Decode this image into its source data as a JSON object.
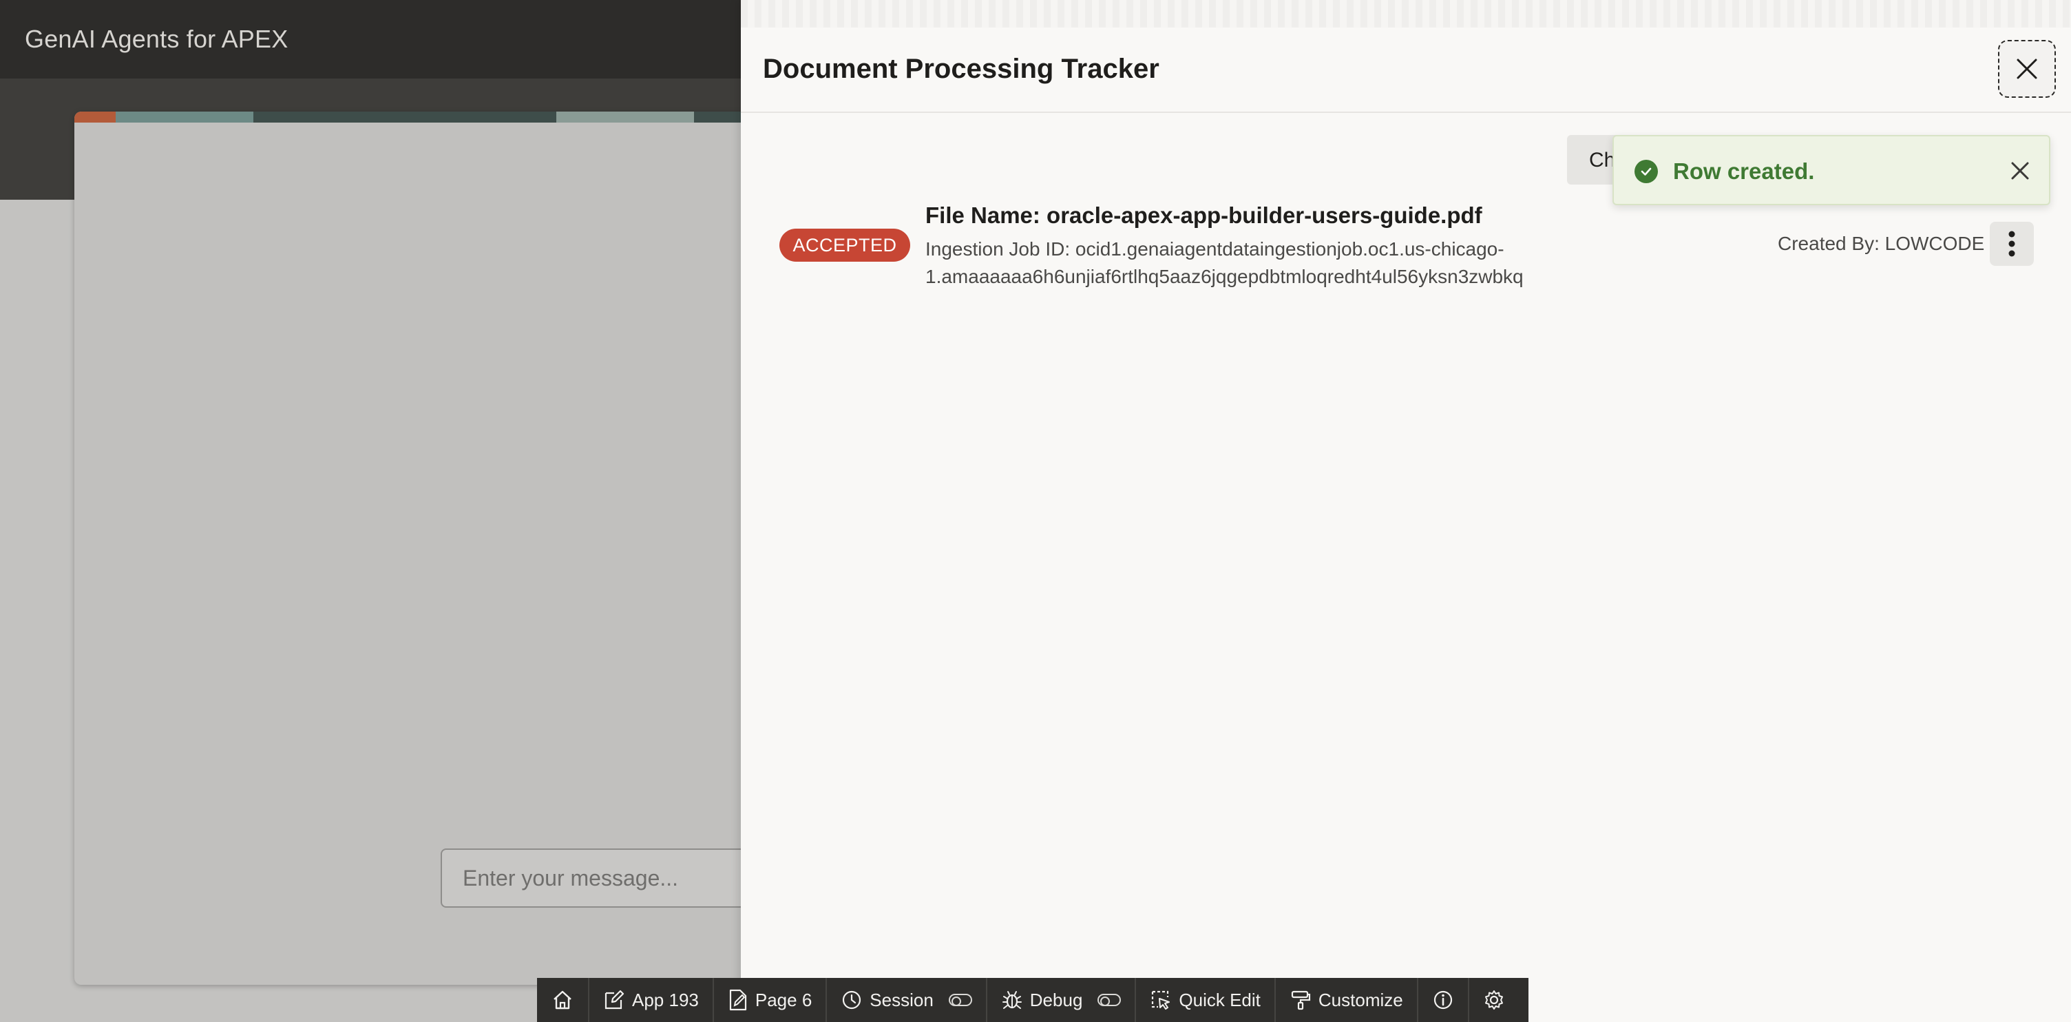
{
  "app": {
    "title": "GenAI Agents for APEX",
    "chat_input_placeholder": "Enter your message..."
  },
  "drawer": {
    "title": "Document Processing Tracker",
    "close_icon": "close-icon",
    "partial_button_label": "Ch",
    "row": {
      "status": "ACCEPTED",
      "status_color": "#c74634",
      "file_name": "File Name: oracle-apex-app-builder-users-guide.pdf",
      "job_id_line1": "Ingestion Job ID: ocid1.genaiagentdataingestionjob.oc1.us-chicago-",
      "job_id_line2": "1.amaaaaaa6h6unjiaf6rtlhq5aaz6jqgepdbtmloqredht4ul56yksn3zwbkq",
      "created_by": "Created By: LOWCODE"
    }
  },
  "toast": {
    "message": "Row created.",
    "color": "#3f7a33"
  },
  "devbar": {
    "home_icon": "home-icon",
    "app_label": "App 193",
    "page_label": "Page 6",
    "session_label": "Session",
    "debug_label": "Debug",
    "quick_edit_label": "Quick Edit",
    "customize_label": "Customize"
  }
}
